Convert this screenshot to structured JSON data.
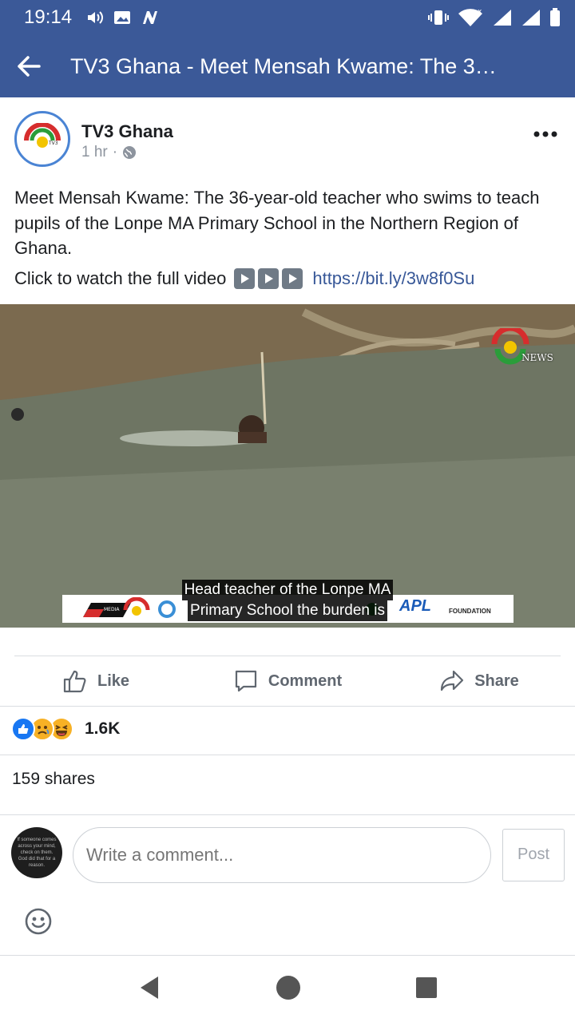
{
  "status_bar": {
    "time": "19:14"
  },
  "app_bar": {
    "title": "TV3 Ghana - Meet Mensah Kwame: The 3…"
  },
  "post": {
    "page_name": "TV3 Ghana",
    "timestamp": "1 hr",
    "separator": "·",
    "avatar_text": "TV3",
    "text": "Meet Mensah Kwame: The 36-year-old teacher who swims to teach pupils of the Lonpe MA Primary School in the Northern Region of Ghana.",
    "cta_text": "Click to watch the full video",
    "link": "https://bit.ly/3w8f0Su"
  },
  "video": {
    "watermark": "NEWS",
    "caption_line1": "Head teacher of the Lonpe MA",
    "caption_line2": "Primary School the burden is",
    "banner": {
      "media_logo": "MEDIA",
      "apl_logo": "APL",
      "foundation_logo": "FOUNDATION"
    }
  },
  "actions": {
    "like": "Like",
    "comment": "Comment",
    "share": "Share"
  },
  "reactions": {
    "count": "1.6K",
    "types": [
      "like",
      "sad",
      "haha"
    ]
  },
  "shares": "159 shares",
  "comment_box": {
    "avatar_text": "If someone comes across your mind, check on them. God did that for a reason.",
    "placeholder": "Write a comment...",
    "post_label": "Post"
  },
  "colors": {
    "brand": "#3b5998",
    "link": "#385898",
    "like_blue": "#1877f2",
    "reaction_yellow": "#f7b125"
  }
}
